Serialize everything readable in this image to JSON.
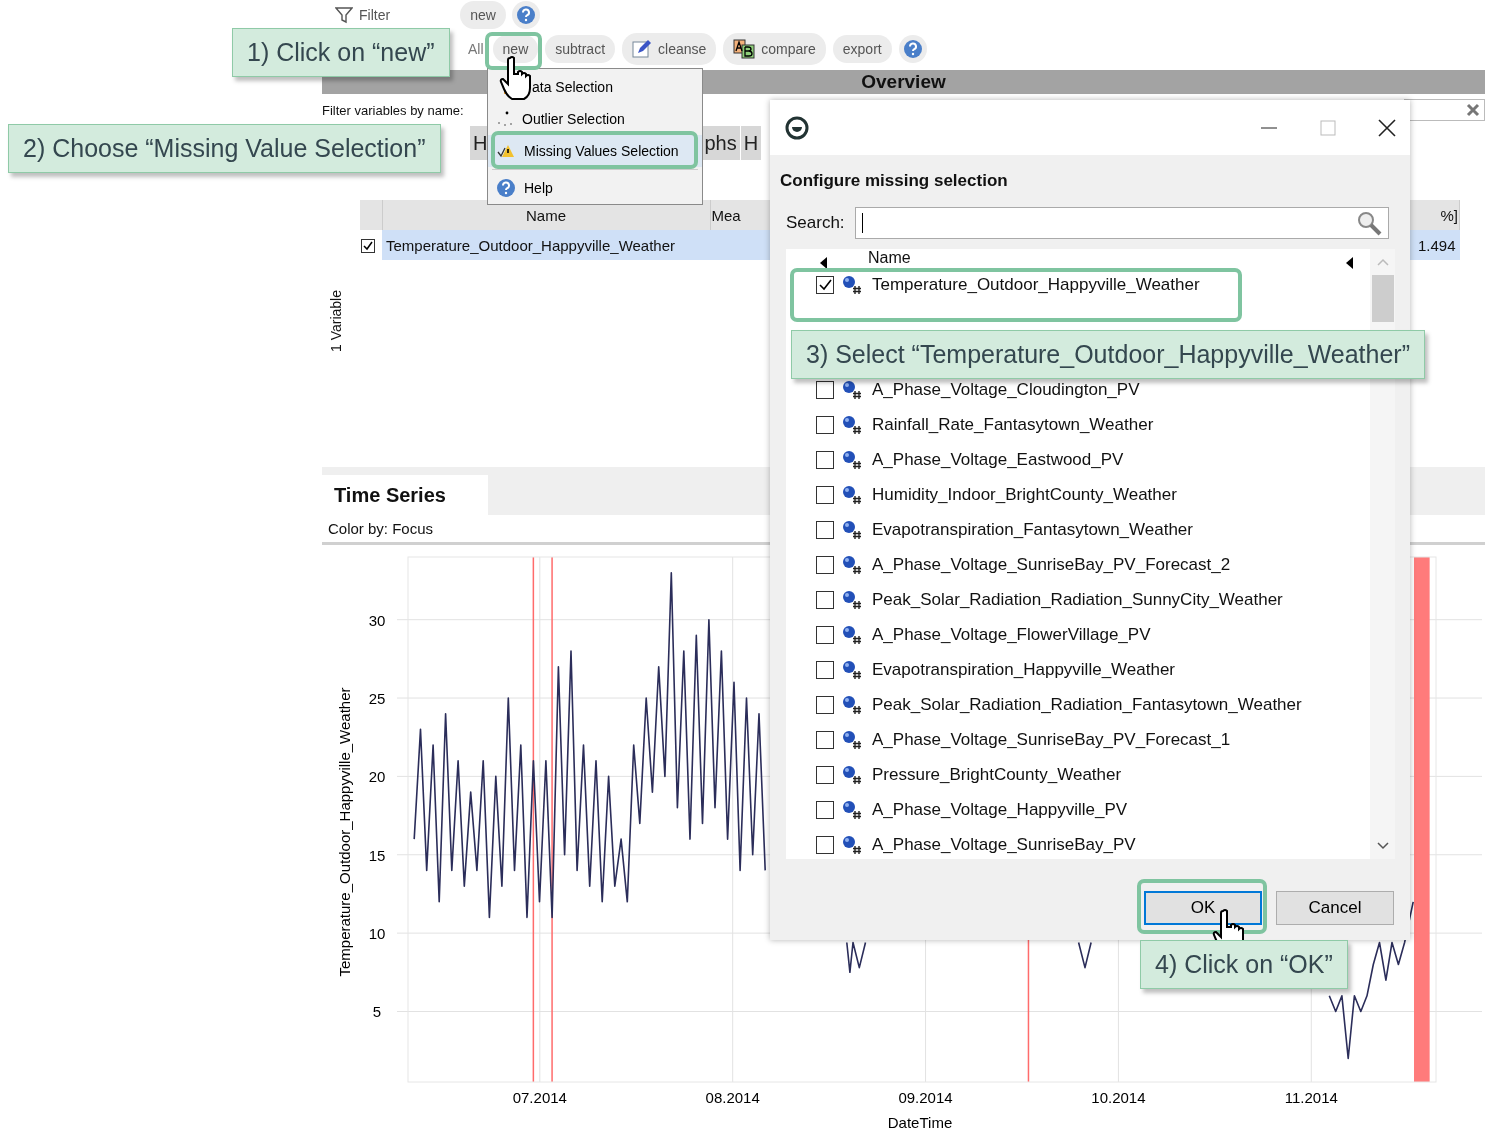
{
  "filter_bar": {
    "label": "Filter",
    "new_button": "new"
  },
  "action_bar": {
    "buttons": [
      {
        "kind": "text",
        "label": "All"
      },
      {
        "kind": "text",
        "label": "new"
      },
      {
        "kind": "text",
        "label": "subtract"
      },
      {
        "kind": "pencil",
        "label": "cleanse"
      },
      {
        "kind": "ab",
        "label": "compare"
      },
      {
        "kind": "text",
        "label": "export"
      },
      {
        "kind": "help"
      }
    ]
  },
  "overview": {
    "title": "Overview",
    "filter_label": "Filter variables by name:",
    "tabs": [
      {
        "label": "H"
      },
      {
        "label": "phs"
      },
      {
        "label": "H"
      }
    ]
  },
  "table": {
    "columns": [
      "Name",
      "Mea",
      "%]"
    ],
    "rows": [
      {
        "checked": true,
        "name": "Temperature_Outdoor_Happyville_Weather",
        "column_3": "1.494"
      }
    ]
  },
  "count_label": "1 Variable",
  "time_series": {
    "tab": "Time Series",
    "color_by": "Color by: Focus",
    "chart_data": {
      "type": "line",
      "xlabel": "DateTime",
      "ylabel": "Temperature_Outdoor_Happyville_Weather",
      "grid": true,
      "xlim": [
        6.518,
        11.848
      ],
      "ylim": [
        0.5,
        34
      ],
      "xticks": [
        {
          "value": 7.2014,
          "label": "07.2014"
        },
        {
          "value": 8.2014,
          "label": "08.2014"
        },
        {
          "value": 9.2014,
          "label": "09.2014"
        },
        {
          "value": 10.2014,
          "label": "10.2014"
        },
        {
          "value": 11.2014,
          "label": "11.2014"
        }
      ],
      "yticks": [
        5,
        10,
        15,
        20,
        25,
        30
      ],
      "x": [
        6.55,
        6.583,
        6.615,
        6.648,
        6.68,
        6.713,
        6.745,
        6.778,
        6.81,
        6.843,
        6.875,
        6.908,
        6.94,
        6.973,
        7.005,
        7.038,
        7.07,
        7.103,
        7.135,
        7.168,
        7.2,
        7.233,
        7.265,
        7.298,
        7.33,
        7.363,
        7.395,
        7.428,
        7.46,
        7.493,
        7.525,
        7.558,
        7.59,
        7.623,
        7.655,
        7.688,
        7.72,
        7.753,
        7.785,
        7.818,
        7.85,
        7.883,
        7.915,
        7.948,
        7.98,
        8.013,
        8.045,
        8.078,
        8.11,
        8.143,
        8.175,
        8.208,
        8.24,
        8.273,
        8.305,
        8.338,
        8.37,
        8.793,
        8.809,
        8.825,
        8.858,
        8.89,
        9.995,
        10.028,
        10.06,
        11.295,
        11.328,
        11.36,
        11.393,
        11.425,
        11.458,
        11.49,
        11.523,
        11.555,
        11.588,
        11.62,
        11.653,
        11.685,
        11.73
      ],
      "series": [
        {
          "color": "#2b2d5a",
          "values": [
            16,
            23,
            14,
            22,
            12,
            24,
            14,
            21,
            13,
            19,
            14,
            21,
            11,
            20,
            13,
            25,
            14,
            22,
            11,
            21,
            12,
            21,
            11,
            27,
            15,
            28,
            14,
            22,
            13,
            21,
            12,
            20,
            13,
            16,
            12,
            22,
            17,
            25,
            19,
            27,
            20,
            33,
            18,
            28,
            16,
            29,
            17,
            30,
            18,
            28,
            16,
            26,
            14,
            25,
            15,
            24,
            14,
            9.4,
            7.5,
            9.4,
            7.8,
            9.4,
            9.4,
            7.8,
            9.4,
            6,
            5,
            6,
            2,
            6,
            5,
            6,
            8,
            9.4,
            7,
            9.4,
            8,
            9.4,
            12
          ]
        }
      ],
      "ref_lines": [
        {
          "axis": "x",
          "value": 7.168
        },
        {
          "axis": "x",
          "value": 7.265
        },
        {
          "axis": "x",
          "value": 9.735
        }
      ],
      "bands": [
        {
          "axis": "x",
          "from": 11.734,
          "to": 11.815
        }
      ]
    }
  },
  "menu": {
    "items": [
      {
        "kind": "data",
        "label": "ata Selection",
        "selected": false
      },
      {
        "kind": "outlier",
        "label": "Outlier Selection",
        "selected": false
      },
      {
        "kind": "missing",
        "label": "Missing Values Selection",
        "selected": true
      },
      {
        "kind": "help",
        "label": "Help",
        "selected": false
      }
    ]
  },
  "dialog": {
    "heading": "Configure missing selection",
    "search_label": "Search:",
    "list_header": "Name",
    "items": [
      {
        "name": "Temperature_Outdoor_Happyville_Weather",
        "checked": true
      },
      {
        "name": "A_Phase_Voltage_Cloudington_PV",
        "checked": false
      },
      {
        "name": "Rainfall_Rate_Fantasytown_Weather",
        "checked": false
      },
      {
        "name": "A_Phase_Voltage_Eastwood_PV",
        "checked": false
      },
      {
        "name": "Humidity_Indoor_BrightCounty_Weather",
        "checked": false
      },
      {
        "name": "Evapotranspiration_Fantasytown_Weather",
        "checked": false
      },
      {
        "name": "A_Phase_Voltage_SunriseBay_PV_Forecast_2",
        "checked": false
      },
      {
        "name": "Peak_Solar_Radiation_Radiation_SunnyCity_Weather",
        "checked": false
      },
      {
        "name": "A_Phase_Voltage_FlowerVillage_PV",
        "checked": false
      },
      {
        "name": "Evapotranspiration_Happyville_Weather",
        "checked": false
      },
      {
        "name": "Peak_Solar_Radiation_Radiation_Fantasytown_Weather",
        "checked": false
      },
      {
        "name": "A_Phase_Voltage_SunriseBay_PV_Forecast_1",
        "checked": false
      },
      {
        "name": "Pressure_BrightCounty_Weather",
        "checked": false
      },
      {
        "name": "A_Phase_Voltage_Happyville_PV",
        "checked": false
      },
      {
        "name": "A_Phase_Voltage_SunriseBay_PV",
        "checked": false
      }
    ],
    "buttons": [
      {
        "label": "OK",
        "focused": true
      },
      {
        "label": "Cancel",
        "focused": false
      }
    ]
  },
  "callouts": [
    {
      "text": "1) Click on “new”"
    },
    {
      "text": "2) Choose “Missing Value Selection”"
    },
    {
      "text": "3) Select “Temperature_Outdoor_Happyville_Weather”"
    },
    {
      "text": "4) Click on “OK”"
    }
  ]
}
